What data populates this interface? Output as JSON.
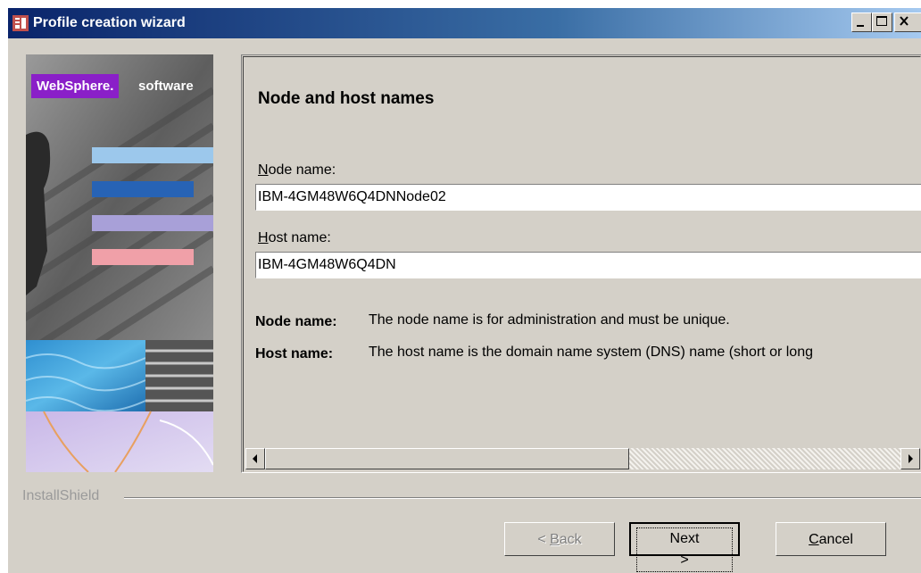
{
  "window": {
    "title": "Profile creation wizard",
    "controls": [
      "minimize-icon",
      "maximize-icon",
      "close-icon"
    ]
  },
  "banner": {
    "logo_text": "WebSphere.",
    "logo_suffix": "software",
    "logo_color": "#8a1fc8"
  },
  "panel": {
    "title": "Node and host names",
    "node_name_label_prefix": "N",
    "node_name_label_rest": "ode name:",
    "node_name_value": "IBM-4GM48W6Q4DNNode02",
    "host_name_label_prefix": "H",
    "host_name_label_rest": "ost name:",
    "host_name_value": "IBM-4GM48W6Q4DN",
    "descriptions": [
      {
        "term": "Node name:",
        "text": "The node name is for administration and must be unique."
      },
      {
        "term": "Host name:",
        "text": "The host name is the domain name system (DNS) name (short or long"
      }
    ]
  },
  "footer": {
    "brand": "InstallShield"
  },
  "buttons": {
    "back_pre": "< ",
    "back_key": "B",
    "back_rest": "ack",
    "next_label": "Next >",
    "cancel_key": "C",
    "cancel_rest": "ancel"
  },
  "colors": {
    "titlebar_start": "#0a246a",
    "titlebar_end": "#a6caf0",
    "dialog_bg": "#d4d0c8"
  }
}
